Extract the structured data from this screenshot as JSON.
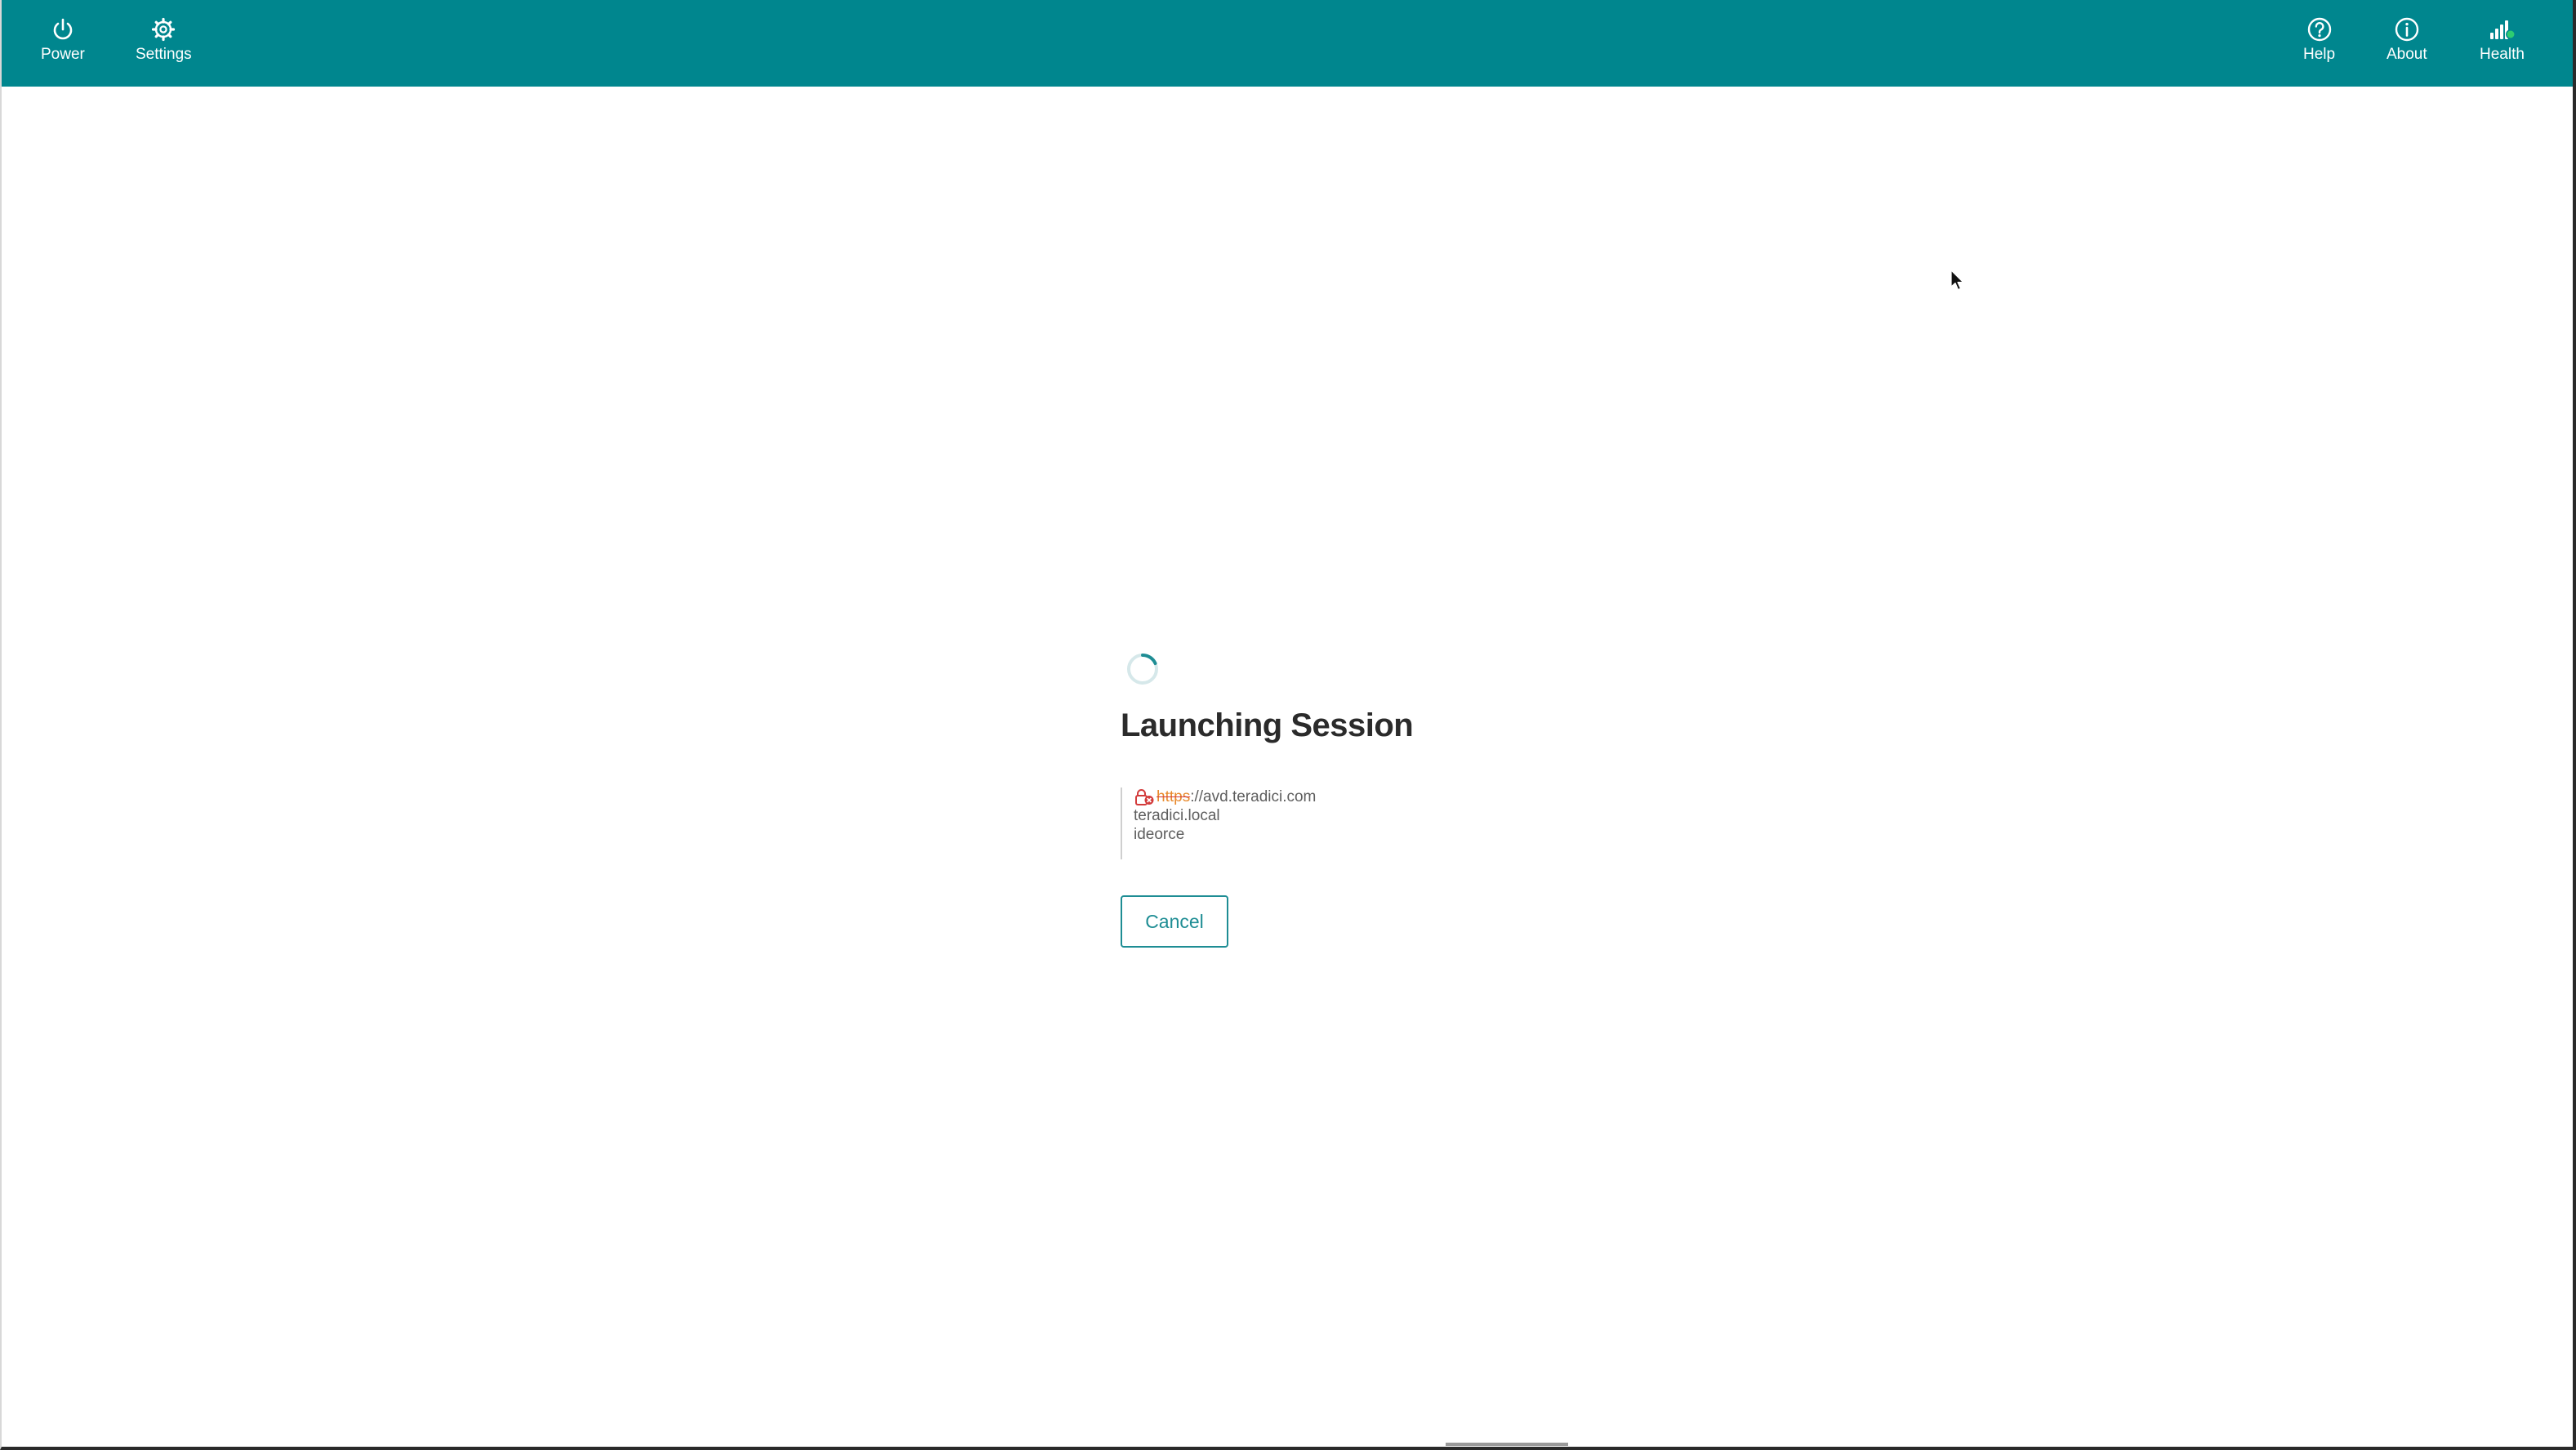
{
  "topbar": {
    "left_items": [
      {
        "label": "Power",
        "icon": "power-icon"
      },
      {
        "label": "Settings",
        "icon": "gear-icon"
      }
    ],
    "right_items": [
      {
        "label": "Help",
        "icon": "help-circle-icon"
      },
      {
        "label": "About",
        "icon": "info-circle-icon"
      },
      {
        "label": "Health",
        "icon": "signal-bars-icon"
      }
    ],
    "color": "#00868e"
  },
  "session": {
    "title": "Launching Session",
    "url_scheme": "https",
    "url_rest": "://avd.teradici.com",
    "domain": "teradici.local",
    "username": "ideorce",
    "cancel_label": "Cancel",
    "insecure_icon": "broken-lock-icon"
  },
  "colors": {
    "accent": "#1e8d94",
    "warning": "#e8892c",
    "error": "#d33b3b"
  }
}
